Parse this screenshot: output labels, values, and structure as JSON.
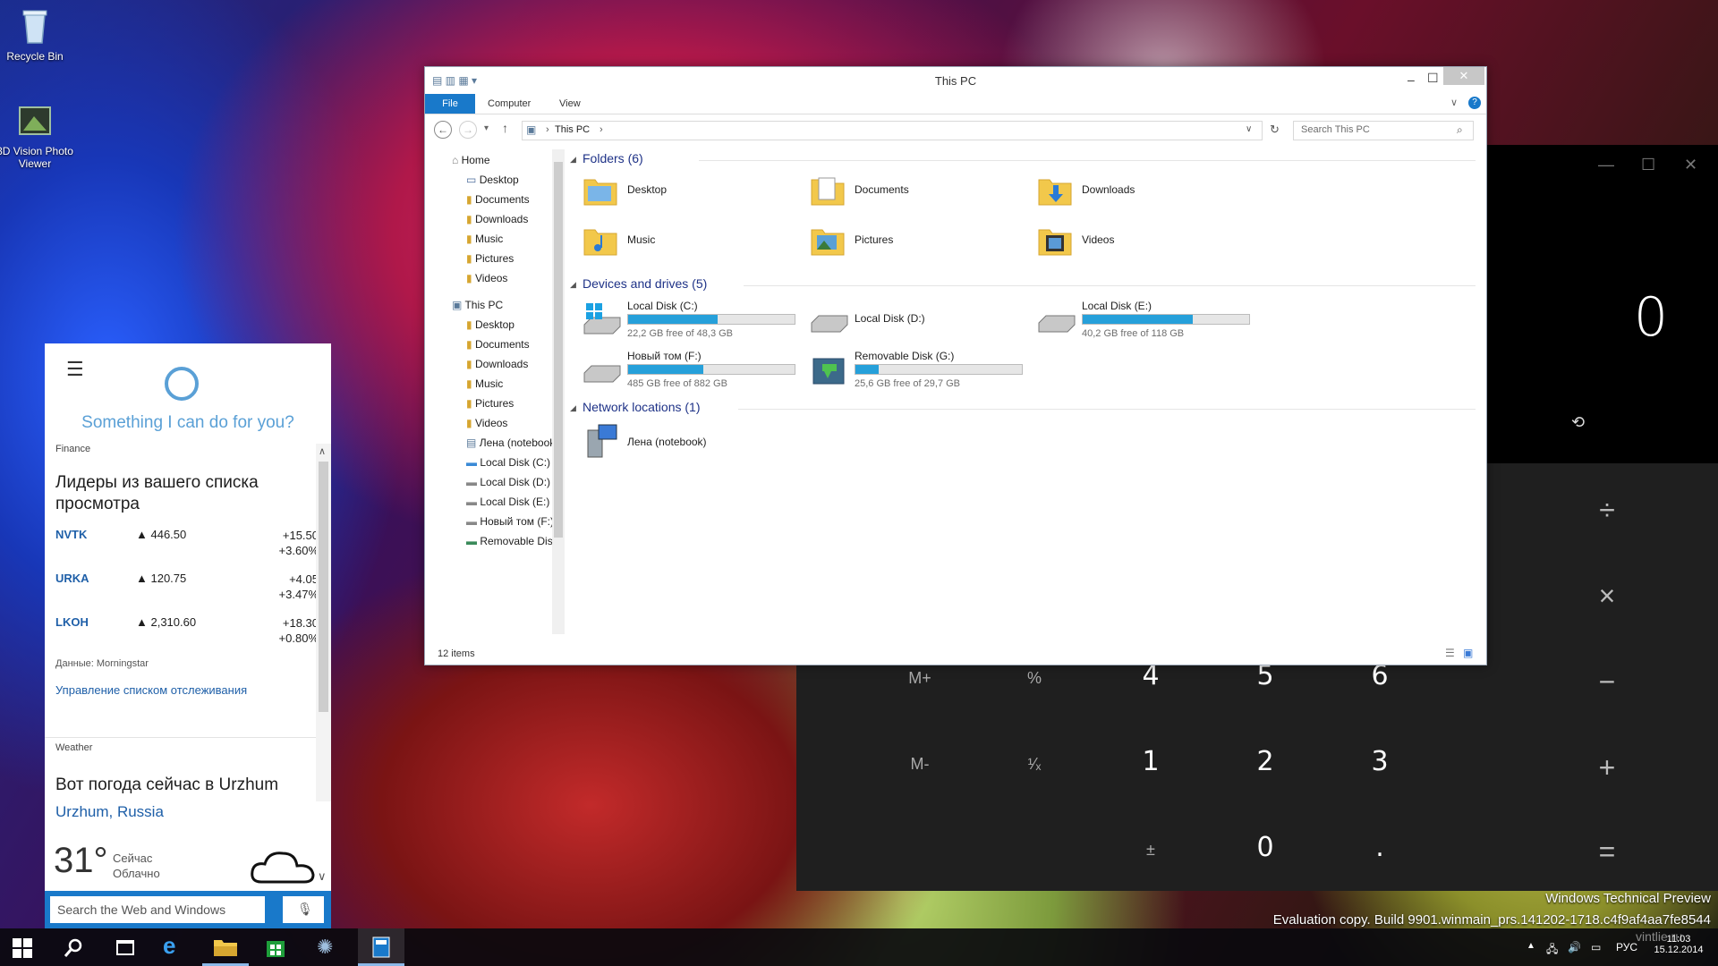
{
  "desktop": {
    "icons": [
      {
        "label": "Recycle Bin"
      },
      {
        "label": "3D Vision Photo Viewer"
      }
    ]
  },
  "calculator": {
    "result": "0",
    "ops": {
      "divide": "÷",
      "multiply": "×",
      "minus": "−",
      "plus": "+",
      "equals": "="
    },
    "memory": {
      "mplus": "M+",
      "mminus": "M-",
      "percent": "%",
      "reciprocal": "¹⁄ₓ",
      "negate": "±"
    },
    "digits": {
      "d4": "4",
      "d5": "5",
      "d6": "6",
      "d1": "1",
      "d2": "2",
      "d3": "3",
      "d0": "0",
      "dot": "."
    }
  },
  "explorer": {
    "title": "This PC",
    "ribbon": {
      "file": "File",
      "computer": "Computer",
      "view": "View"
    },
    "address": {
      "path": "This PC"
    },
    "search": {
      "placeholder": "Search This PC"
    },
    "nav": {
      "home": "Home",
      "quick": [
        "Desktop",
        "Documents",
        "Downloads",
        "Music",
        "Pictures",
        "Videos"
      ],
      "thispc": "This PC",
      "pc_items": [
        "Desktop",
        "Documents",
        "Downloads",
        "Music",
        "Pictures",
        "Videos",
        "Лена (notebook)",
        "Local Disk (C:)",
        "Local Disk (D:)",
        "Local Disk (E:)",
        "Новый том (F:)",
        "Removable Disk (G:)"
      ]
    },
    "groups": {
      "folders": "Folders (6)",
      "drives": "Devices and drives (5)",
      "network": "Network locations (1)"
    },
    "folders": [
      "Desktop",
      "Documents",
      "Downloads",
      "Music",
      "Pictures",
      "Videos"
    ],
    "drives": [
      {
        "name": "Local Disk (C:)",
        "free": "22,2 GB free of 48,3 GB",
        "used_fraction": 0.54
      },
      {
        "name": "Local Disk (D:)",
        "free": "",
        "used_fraction": null
      },
      {
        "name": "Local Disk (E:)",
        "free": "40,2 GB free of 118 GB",
        "used_fraction": 0.66
      },
      {
        "name": "Новый том (F:)",
        "free": "485 GB free of 882 GB",
        "used_fraction": 0.45
      },
      {
        "name": "Removable Disk (G:)",
        "free": "25,6 GB free of 29,7 GB",
        "used_fraction": 0.14
      }
    ],
    "network": [
      "Лена (notebook)"
    ],
    "status": "12 items"
  },
  "cortana": {
    "prompt": "Something I can do for you?",
    "finance_label": "Finance",
    "finance_heading": "Лидеры из вашего списка просмотра",
    "stocks": [
      {
        "symbol": "NVTK",
        "value": "▲ 446.50",
        "change": "+15.50",
        "percent": "+3.60%"
      },
      {
        "symbol": "URKA",
        "value": "▲ 120.75",
        "change": "+4.05",
        "percent": "+3.47%"
      },
      {
        "symbol": "LKOH",
        "value": "▲ 2,310.60",
        "change": "+18.30",
        "percent": "+0.80%"
      }
    ],
    "source": "Данные: Morningstar",
    "manage_link": "Управление списком отслеживания",
    "weather_label": "Weather",
    "weather_heading": "Вот погода сейчас в Urzhum",
    "location": "Urzhum, Russia",
    "temp": "31°",
    "now": "Сейчас",
    "condition": "Облачно",
    "search_placeholder": "Search the Web and Windows"
  },
  "watermark": {
    "line1": "Windows Technical Preview",
    "line2": "Evaluation copy. Build 9901.winmain_prs.141202-1718.c4f9af4aa7fe8544"
  },
  "taskbar": {
    "lang": "РУС",
    "time": "11:03",
    "date": "15.12.2014",
    "site": "vintlie.ru"
  },
  "colors": {
    "accent": "#1979ca",
    "progress": "#26a0da",
    "cortana_text": "#5aa0d6"
  }
}
